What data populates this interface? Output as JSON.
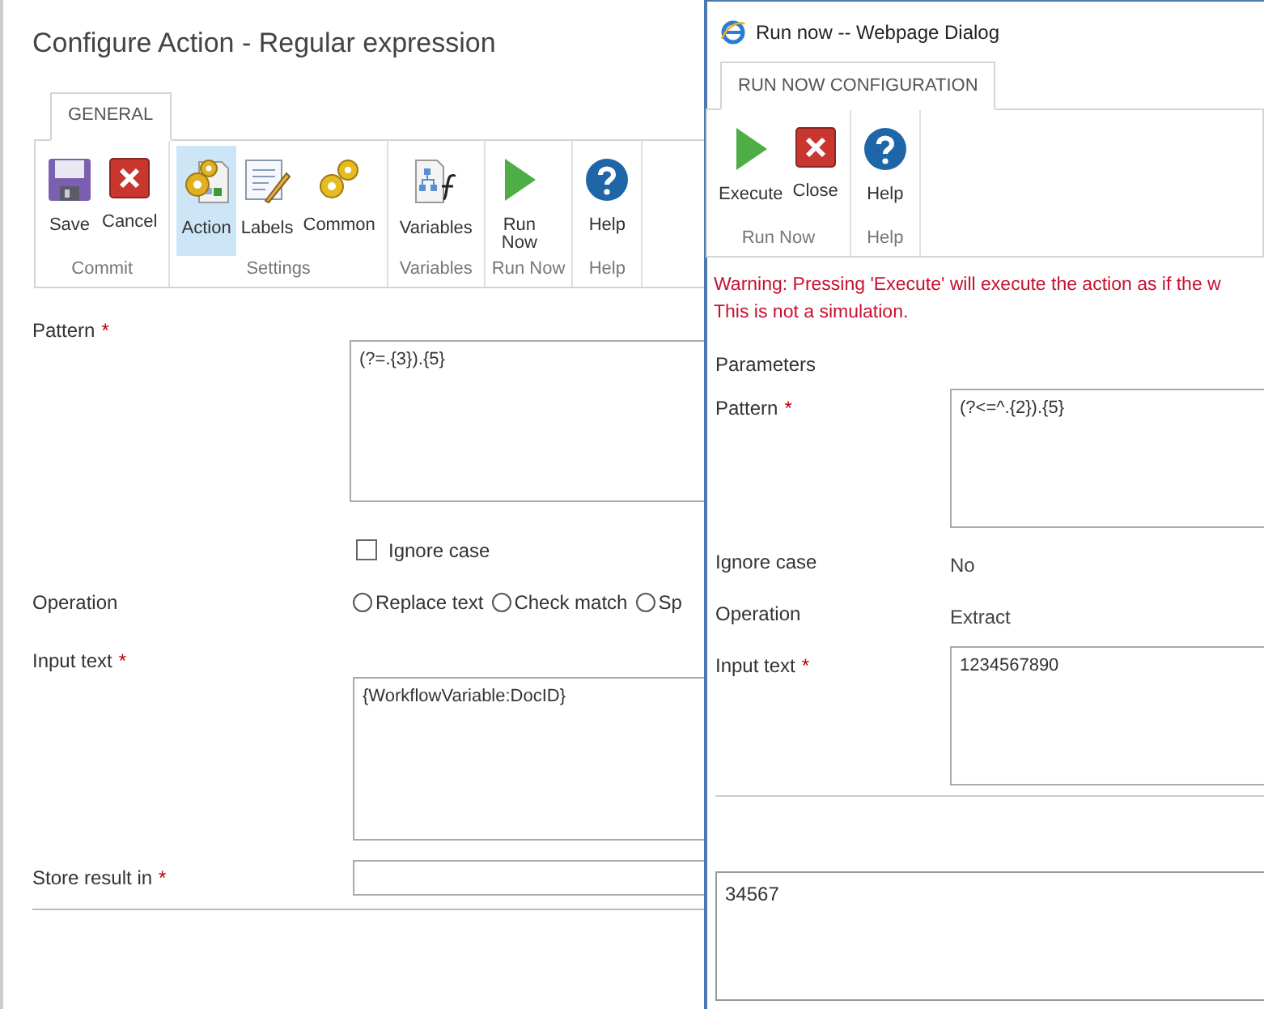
{
  "page": {
    "title": "Configure Action - Regular expression",
    "tabs": [
      {
        "label": "GENERAL",
        "selected": true
      }
    ],
    "ribbon": [
      {
        "label": "Commit",
        "buttons": [
          {
            "label": "Save",
            "kind": "save",
            "selected": false
          },
          {
            "label": "Cancel",
            "kind": "cancel",
            "selected": false
          }
        ]
      },
      {
        "label": "Settings",
        "buttons": [
          {
            "label": "Action",
            "kind": "action",
            "selected": true
          },
          {
            "label": "Labels",
            "kind": "labels",
            "selected": false
          },
          {
            "label": "Common",
            "kind": "common",
            "selected": false
          }
        ]
      },
      {
        "label": "Variables",
        "buttons": [
          {
            "label": "Variables",
            "kind": "variables",
            "selected": false
          }
        ]
      },
      {
        "label": "Run Now",
        "buttons": [
          {
            "label": "Run Now",
            "kind": "run",
            "selected": false
          }
        ]
      },
      {
        "label": "Help",
        "buttons": [
          {
            "label": "Help",
            "kind": "help",
            "selected": false
          }
        ]
      }
    ],
    "form": {
      "pattern": {
        "label": "Pattern",
        "required_mark": "*",
        "value": "(?=.{3}).{5}"
      },
      "ignore_case": {
        "label": "Ignore case",
        "checked": false
      },
      "operation": {
        "label": "Operation",
        "options": [
          {
            "label": "Replace text",
            "selected": false
          },
          {
            "label": "Check match",
            "selected": false
          },
          {
            "label": "Sp",
            "selected": false
          }
        ]
      },
      "input_text": {
        "label": "Input text",
        "required_mark": "*",
        "value": "{WorkflowVariable:DocID}"
      },
      "store_result": {
        "label": "Store result in",
        "required_mark": "*"
      }
    }
  },
  "dialog": {
    "title": "Run now -- Webpage Dialog",
    "tabs": [
      {
        "label": "RUN NOW CONFIGURATION",
        "selected": true
      }
    ],
    "ribbon": [
      {
        "label": "Run Now",
        "buttons": [
          {
            "label": "Execute",
            "kind": "run",
            "selected": false
          },
          {
            "label": "Close",
            "kind": "cancel",
            "selected": false
          }
        ]
      },
      {
        "label": "Help",
        "buttons": [
          {
            "label": "Help",
            "kind": "help",
            "selected": false
          }
        ]
      }
    ],
    "warning": [
      "Warning: Pressing 'Execute' will execute the action as if the w",
      "This is not a simulation."
    ],
    "parameters_heading": "Parameters",
    "parameters": [
      {
        "label": "Pattern",
        "required_mark": "*",
        "kind": "field",
        "value": "(?<=^.{2}).{5}"
      },
      {
        "label": "Ignore case",
        "kind": "text",
        "value": "No"
      },
      {
        "label": "Operation",
        "kind": "text",
        "value": "Extract"
      },
      {
        "label": "Input text",
        "required_mark": "*",
        "kind": "field",
        "value": "1234567890"
      }
    ],
    "result": "34567"
  }
}
